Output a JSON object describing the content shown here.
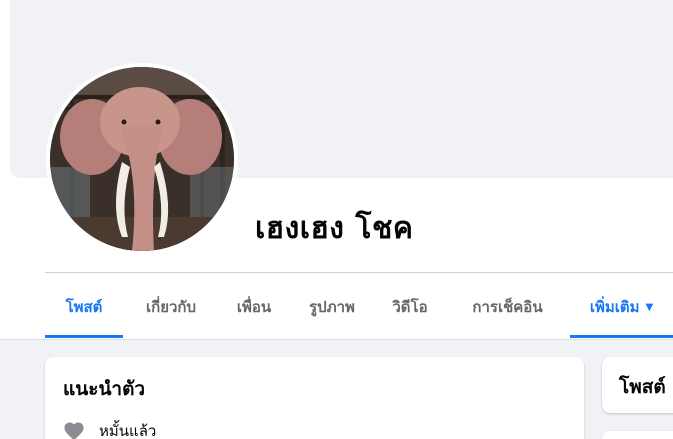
{
  "profile": {
    "name": "เฮงเฮง โชค"
  },
  "tabs": [
    {
      "label": "โพสต์",
      "active": true
    },
    {
      "label": "เกี่ยวกับ",
      "active": false
    },
    {
      "label": "เพื่อน",
      "active": false
    },
    {
      "label": "รูปภาพ",
      "active": false
    },
    {
      "label": "วิดีโอ",
      "active": false
    },
    {
      "label": "การเช็คอิน",
      "active": false
    },
    {
      "label": "เพิ่มเติม",
      "active": false,
      "icon": "caret-down-icon"
    }
  ],
  "intro": {
    "title": "แนะนำตัว",
    "relationship": "หมั้นแล้ว",
    "relationship_icon": "heart-icon"
  },
  "posts_card": {
    "title": "โพสต์"
  },
  "colors": {
    "accent": "#1877f2",
    "background": "#f0f2f5",
    "text": "#050505",
    "muted": "#65676b"
  }
}
